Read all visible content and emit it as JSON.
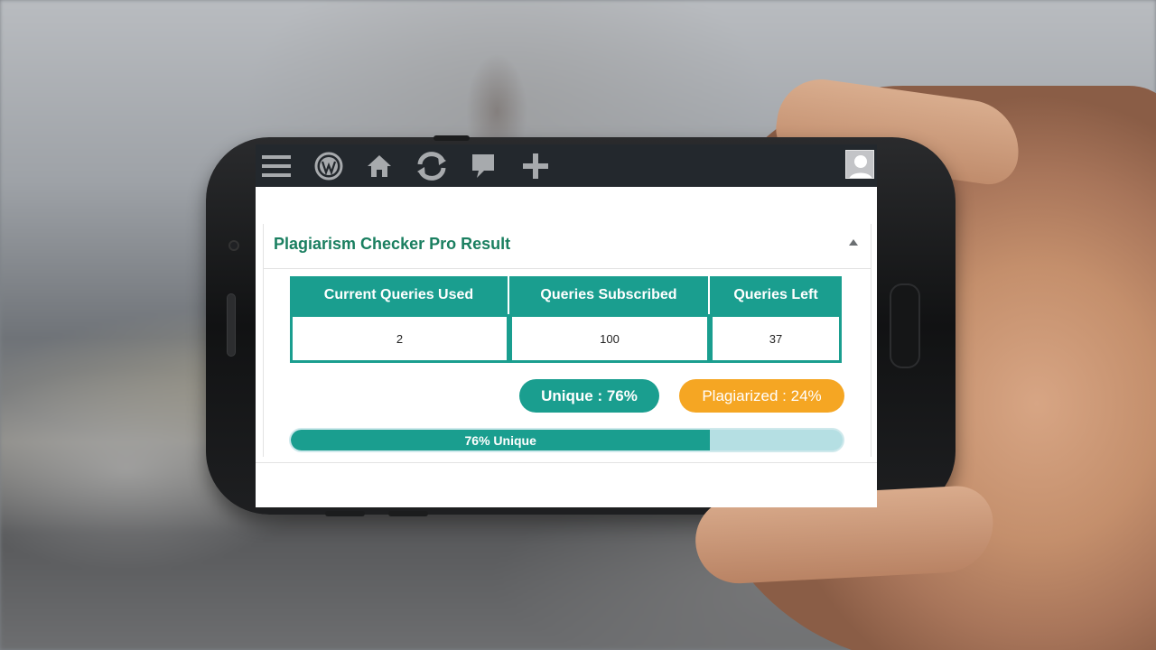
{
  "toolbar": {
    "icons": [
      "menu-icon",
      "wordpress-icon",
      "home-icon",
      "refresh-icon",
      "comment-icon",
      "plus-icon",
      "user-avatar-icon"
    ],
    "color": "#a7aaad",
    "background": "#23282d"
  },
  "panel": {
    "title": "Plagiarism Checker Pro Result",
    "title_color": "#1a7f60"
  },
  "quota_table": {
    "headers": [
      "Current Queries Used",
      "Queries Subscribed",
      "Queries Left"
    ],
    "values": [
      "2",
      "100",
      "37"
    ],
    "accent": "#1a9e8f"
  },
  "result": {
    "unique_label": "Unique : 76%",
    "plagiarized_label": "Plagiarized : 24%",
    "unique_color": "#1a9e8f",
    "plagiarized_color": "#f5a623"
  },
  "progress": {
    "label": "76% Unique",
    "value": 0.76
  }
}
